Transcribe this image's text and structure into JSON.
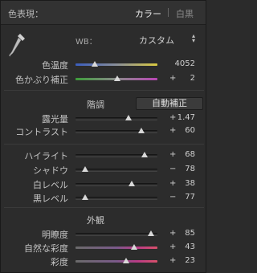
{
  "header": {
    "title": "色表現：",
    "mode_color": "カラー",
    "mode_bw": "白黒"
  },
  "wb": {
    "label": "WB：",
    "value": "カスタム",
    "caret": "▴▾"
  },
  "basic": [
    {
      "label": "色温度",
      "sign": "",
      "value": "4052",
      "track": "temp",
      "level": 0.24
    },
    {
      "label": "色かぶり補正",
      "sign": "+",
      "value": "2",
      "track": "tint",
      "level": 0.51
    }
  ],
  "tone": {
    "title": "階調",
    "auto_label": "自動補正",
    "sliders": [
      {
        "label": "露光量",
        "sign": "+",
        "value": "1.47",
        "level": 0.65
      },
      {
        "label": "コントラスト",
        "sign": "+",
        "value": "60",
        "level": 0.8
      }
    ]
  },
  "tone2": [
    {
      "label": "ハイライト",
      "sign": "+",
      "value": "68",
      "level": 0.84
    },
    {
      "label": "シャドウ",
      "sign": "−",
      "value": "78",
      "level": 0.12
    },
    {
      "label": "白レベル",
      "sign": "+",
      "value": "38",
      "level": 0.69
    },
    {
      "label": "黒レベル",
      "sign": "−",
      "value": "77",
      "level": 0.12
    }
  ],
  "presence": {
    "title": "外観",
    "sliders": [
      {
        "label": "明瞭度",
        "sign": "+",
        "value": "85",
        "track": "gray",
        "level": 0.92
      },
      {
        "label": "自然な彩度",
        "sign": "+",
        "value": "43",
        "track": "sat",
        "level": 0.72
      },
      {
        "label": "彩度",
        "sign": "+",
        "value": "23",
        "track": "sat",
        "level": 0.62
      }
    ]
  },
  "colors": {
    "panel_bg": "#2c2c2c",
    "thumb": "#d8d8d8",
    "text": "#c4c4c4"
  }
}
